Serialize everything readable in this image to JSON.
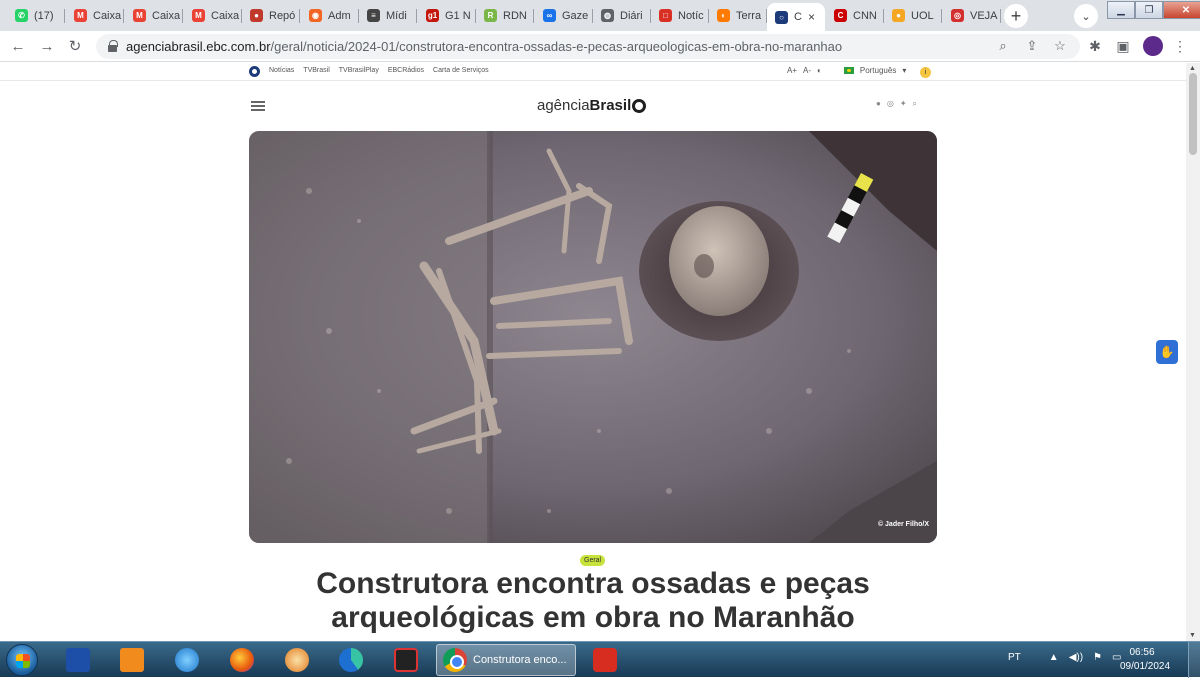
{
  "tabs": [
    {
      "label": "(17)",
      "icon": "whatsapp-icon",
      "color": "#25d366",
      "glyph": "✆"
    },
    {
      "label": "Caixa",
      "icon": "gmail-icon",
      "color": "#ea4335",
      "glyph": "M"
    },
    {
      "label": "Caixa",
      "icon": "gmail-icon",
      "color": "#ea4335",
      "glyph": "M"
    },
    {
      "label": "Caixa",
      "icon": "gmail-icon",
      "color": "#ea4335",
      "glyph": "M"
    },
    {
      "label": "Repó",
      "icon": "news-icon",
      "color": "#c0392b",
      "glyph": "●"
    },
    {
      "label": "Adm",
      "icon": "rss-icon",
      "color": "#f26522",
      "glyph": "◉"
    },
    {
      "label": "Mídi",
      "icon": "media-icon",
      "color": "#444444",
      "glyph": "≡"
    },
    {
      "label": "G1 N",
      "icon": "g1-icon",
      "color": "#c4170c",
      "glyph": "g1"
    },
    {
      "label": "RDN",
      "icon": "rdn-icon",
      "color": "#7ab648",
      "glyph": "R"
    },
    {
      "label": "Gaze",
      "icon": "gazeta-icon",
      "color": "#1a73e8",
      "glyph": "∞"
    },
    {
      "label": "Diári",
      "icon": "globe-icon",
      "color": "#5f6368",
      "glyph": "◍"
    },
    {
      "label": "Notíc",
      "icon": "notice-icon",
      "color": "#d93025",
      "glyph": "□"
    },
    {
      "label": "Terra",
      "icon": "terra-icon",
      "color": "#ff7a00",
      "glyph": "◐"
    },
    {
      "label": "C",
      "icon": "agencia-brasil-icon",
      "color": "#1b3b7a",
      "glyph": "○"
    },
    {
      "label": "CNN",
      "icon": "cnn-icon",
      "color": "#cc0000",
      "glyph": "C"
    },
    {
      "label": "UOL",
      "icon": "uol-icon",
      "color": "#f5a623",
      "glyph": "●"
    },
    {
      "label": "VEJA",
      "icon": "veja-icon",
      "color": "#d32f2f",
      "glyph": "◎"
    }
  ],
  "active_tab_index": 13,
  "tab_close_glyph": "×",
  "new_tab_glyph": "+",
  "tab_search_glyph": "⌄",
  "window_controls": {
    "minimize": "▁",
    "maximize": "❐",
    "close": "✕"
  },
  "toolbar": {
    "back": "←",
    "forward": "→",
    "reload": "↻",
    "url_host": "agenciabrasil.ebc.com.br",
    "url_path": "/geral/noticia/2024-01/construtora-encontra-ossadas-e-pecas-arqueologicas-em-obra-no-maranhao",
    "zoom_icon": "⌕",
    "share_icon": "⇪",
    "star_icon": "☆",
    "extensions_icon": "✱",
    "sidepanel_icon": "▣",
    "menu_icon": "⋮"
  },
  "site_topbar": {
    "links": [
      "Notícias",
      "TVBrasil",
      "TVBrasilPlay",
      "EBCRádios",
      "Carta de Serviços"
    ],
    "font_controls": [
      "A+",
      "A-",
      "◐"
    ],
    "language": "Português",
    "language_arrow": "▾",
    "info": "i"
  },
  "header": {
    "logo_light": "agência",
    "logo_bold": "Brasil",
    "social_icons": [
      "●",
      "◎",
      "✦",
      "⌕"
    ]
  },
  "article": {
    "image_credit": "© Jader Filho/X",
    "category": "Geral",
    "headline": "Construtora encontra ossadas e peças arqueológicas em obra no Maranhão"
  },
  "accessibility_button": "✋",
  "taskbar": {
    "chrome_label": "Construtora enco...",
    "language": "PT",
    "tray_icons": [
      "▲",
      "◀))",
      "⚑",
      "▭"
    ],
    "time": "06:56",
    "date": "09/01/2024"
  }
}
